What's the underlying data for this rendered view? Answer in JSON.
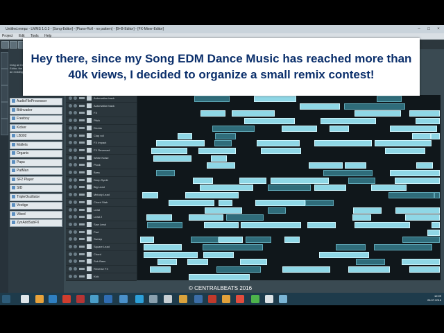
{
  "window": {
    "title": "Untitled.mmpz - LMMS 1.0.3 - [Song-Editor] - [Piano-Roll - no pattern] - [B+B-Editor] - [FX-Mixer-Editor]"
  },
  "menubar": [
    "Project",
    "Edit",
    "Tools",
    "Help"
  ],
  "plugin_panel": {
    "info": "Drag an instrument into either the Song-Editor, the Beat+Bassline Editor or into an existing instrument track.",
    "plugins": [
      "AudioFileProcessor",
      "BitInvader",
      "Freeboy",
      "Kicker",
      "LB302",
      "Mallets",
      "Organic",
      "Papu",
      "PatMan",
      "SF2 Player",
      "SID",
      "TripleOscillator",
      "Vestige",
      "Vibed",
      "ZynAddSubFX"
    ]
  },
  "banner": {
    "text": "Hey there, since my Song EDM Dance Music has reached more than 40k views, I decided to organize a small remix contest!"
  },
  "tracks": [
    "Automation track",
    "Automation track",
    "FX",
    "Pitch",
    "Drums",
    "Clap roll",
    "FX Impact",
    "FX Reversed",
    "White Noise",
    "Pluck",
    "Bass",
    "Deep Synth",
    "Big Lead",
    "Melody Lead",
    "Chord Stab",
    "Lead",
    "Lead 2",
    "Saw Lead",
    "Pad",
    "Sweep",
    "Square Lead",
    "Chord",
    "Sub Bass",
    "Reverse FX",
    "Kick"
  ],
  "copyright": "© CENTRALBEATS 2016",
  "taskbar": {
    "time": "12:09",
    "date": "26.07.2016"
  },
  "colors": {
    "segment": "#8fd7e6",
    "segment_dark": "#2f6c7a",
    "banner_text": "#0b2f6b",
    "taskbar": "#1e3b4b"
  }
}
